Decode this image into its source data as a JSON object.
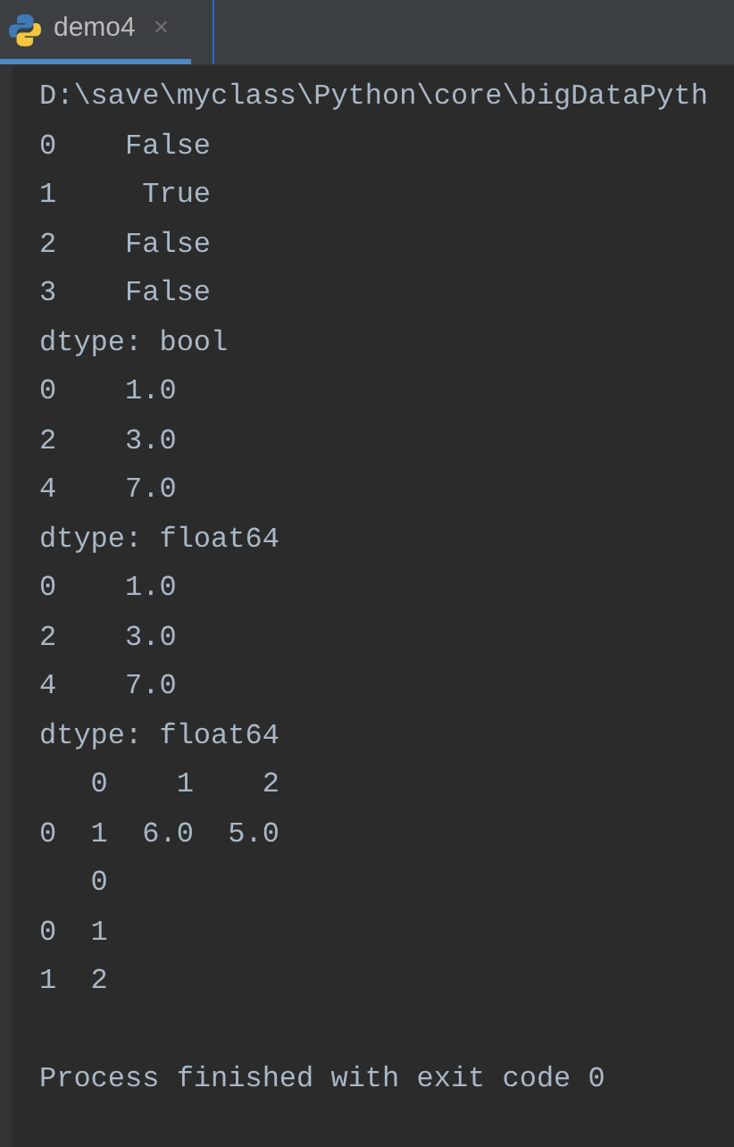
{
  "tabs": [
    {
      "label": "demo4",
      "selected": true,
      "close": "×"
    }
  ],
  "console": {
    "lines": [
      {
        "kind": "text",
        "text": "D:\\save\\myclass\\Python\\core\\bigDataPyth"
      },
      {
        "kind": "text",
        "text": "0    False"
      },
      {
        "kind": "text",
        "text": "1     True"
      },
      {
        "kind": "text",
        "text": "2    False"
      },
      {
        "kind": "text",
        "text": "3    False"
      },
      {
        "kind": "text",
        "text": "dtype: bool"
      },
      {
        "kind": "text",
        "text": "0    1.0"
      },
      {
        "kind": "text",
        "text": "2    3.0"
      },
      {
        "kind": "text",
        "text": "4    7.0"
      },
      {
        "kind": "text",
        "text": "dtype: float64"
      },
      {
        "kind": "text",
        "text": "0    1.0"
      },
      {
        "kind": "text",
        "text": "2    3.0"
      },
      {
        "kind": "text",
        "text": "4    7.0"
      },
      {
        "kind": "text",
        "text": "dtype: float64"
      },
      {
        "kind": "text",
        "text": "   0    1    2"
      },
      {
        "kind": "text",
        "text": "0  1  6.0  5.0"
      },
      {
        "kind": "text",
        "text": "   0"
      },
      {
        "kind": "text",
        "text": "0  1"
      },
      {
        "kind": "text",
        "text": "1  2"
      },
      {
        "kind": "blank"
      },
      {
        "kind": "text",
        "text": "Process finished with exit code 0"
      }
    ]
  }
}
